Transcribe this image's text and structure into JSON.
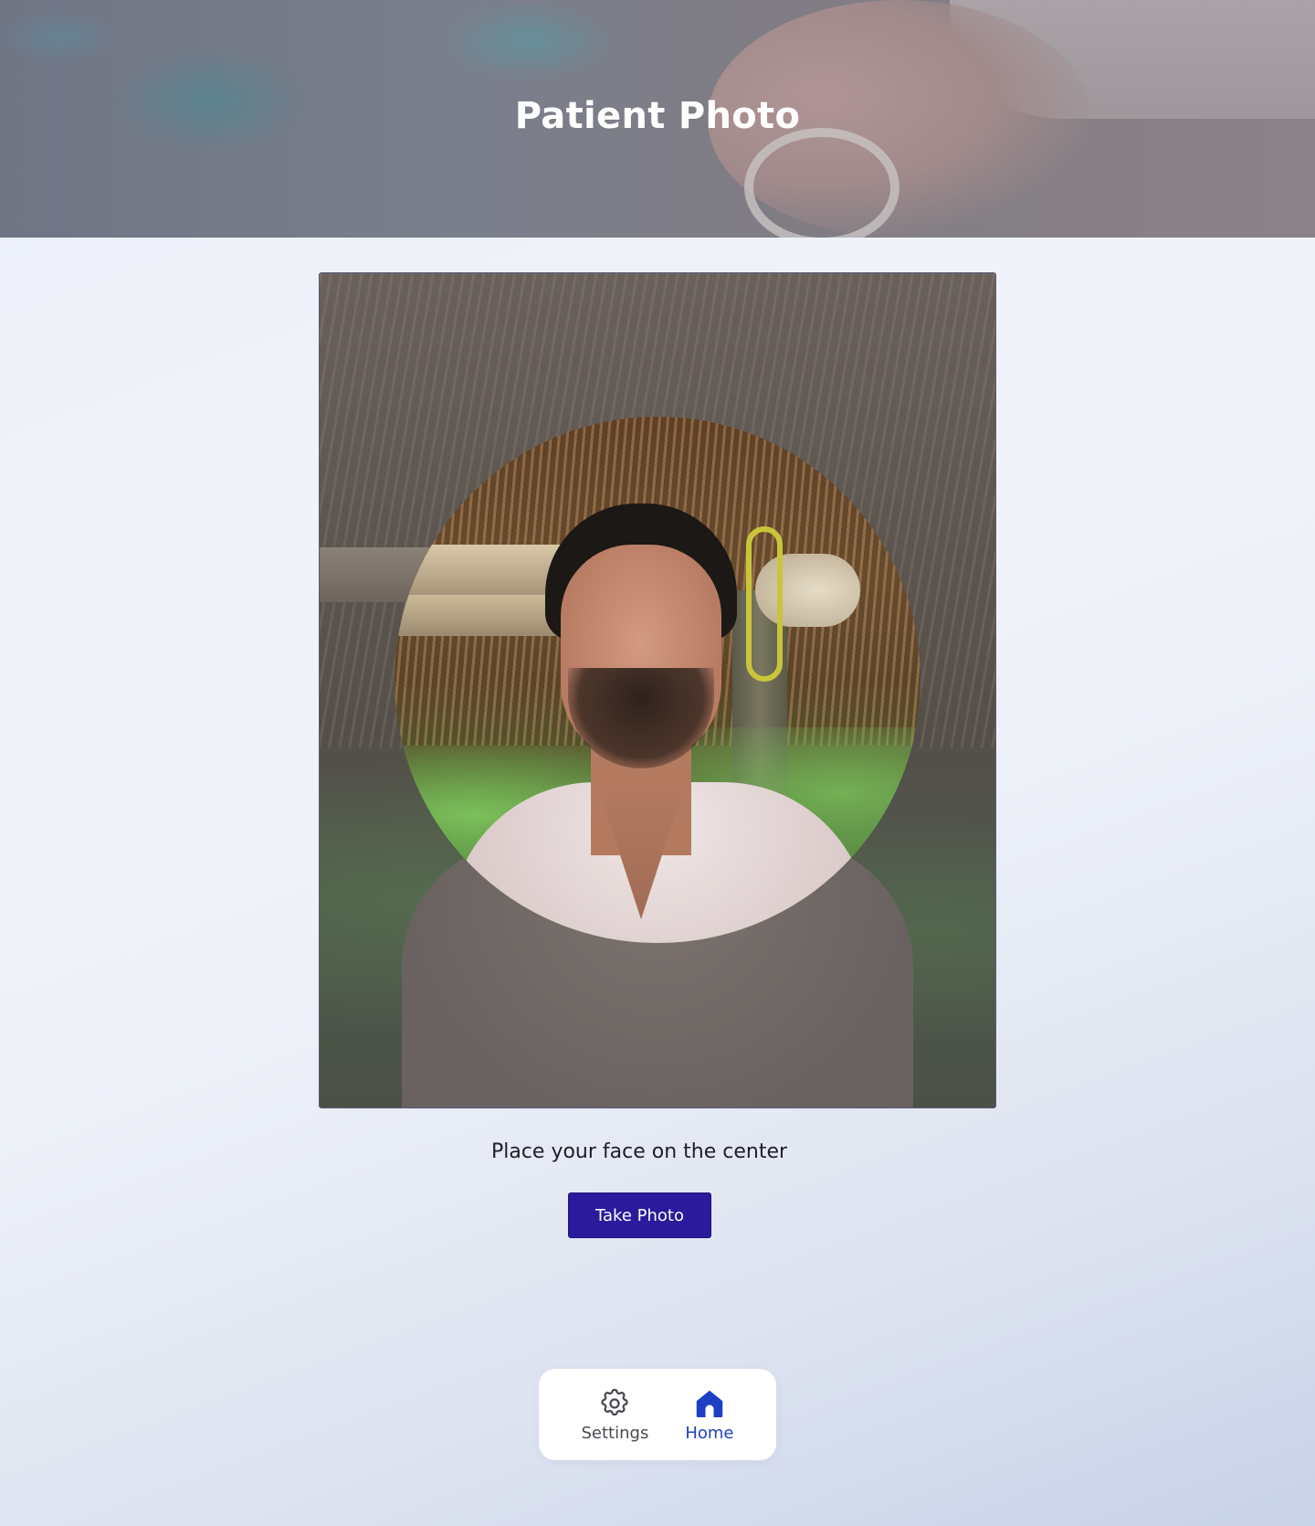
{
  "header": {
    "title": "Patient Photo"
  },
  "camera": {
    "instruction": "Place your face on the center"
  },
  "actions": {
    "take_photo_label": "Take Photo"
  },
  "nav": {
    "settings_label": "Settings",
    "home_label": "Home",
    "active": "home"
  },
  "colors": {
    "primary_button": "#2b1a9c",
    "nav_active": "#1e3fc4",
    "nav_inactive": "#4a4a52"
  },
  "icons": {
    "settings": "gear-icon",
    "home": "home-icon"
  }
}
